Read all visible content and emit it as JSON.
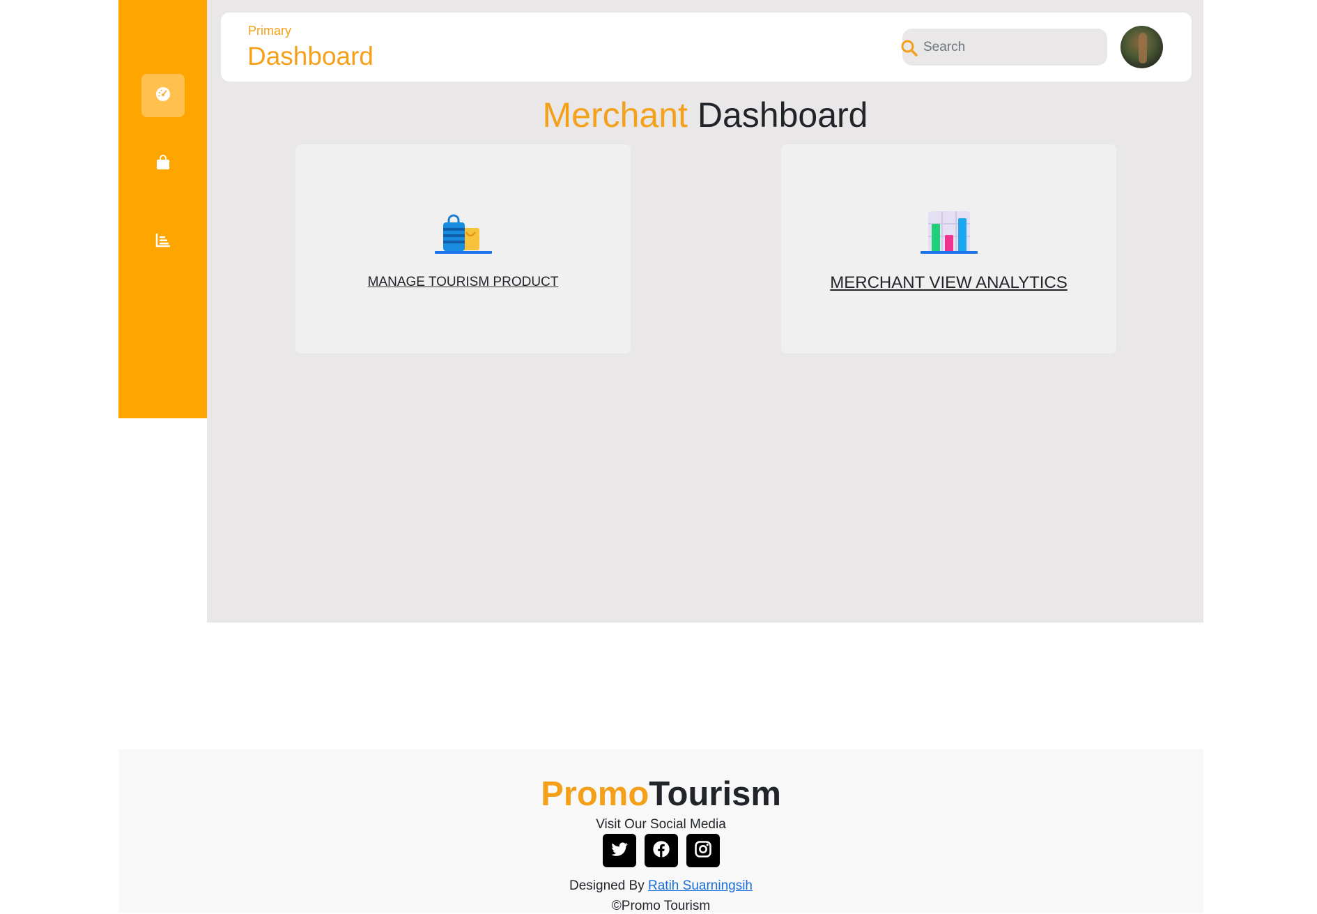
{
  "sidebar": {
    "items": [
      {
        "icon": "gauge-icon",
        "active": true
      },
      {
        "icon": "shopping-bag-icon",
        "active": false
      },
      {
        "icon": "bar-chart-icon",
        "active": false
      }
    ]
  },
  "header": {
    "breadcrumb": "Primary",
    "title": "Dashboard",
    "search_placeholder": "Search"
  },
  "main": {
    "heading_accent": "Merchant",
    "heading_rest": "Dashboard",
    "cards": [
      {
        "label": "MANAGE TOURISM PRODUCT",
        "icon": "shopping-bags-icon"
      },
      {
        "label": "MERCHANT VIEW ANALYTICS",
        "icon": "analytics-chart-icon"
      }
    ]
  },
  "footer": {
    "brand_accent": "Promo",
    "brand_rest": "Tourism",
    "social_label": "Visit Our Social Media",
    "socials": [
      "twitter-icon",
      "facebook-icon",
      "instagram-icon"
    ],
    "designed_prefix": "Designed By",
    "designer_name": "Ratih Suarningsih",
    "copyright": "©Promo Tourism"
  },
  "colors": {
    "accent": "#f5a01a",
    "sidebar": "#ffa500",
    "main_bg": "#e9e7e8",
    "link": "#1a6ed8"
  }
}
